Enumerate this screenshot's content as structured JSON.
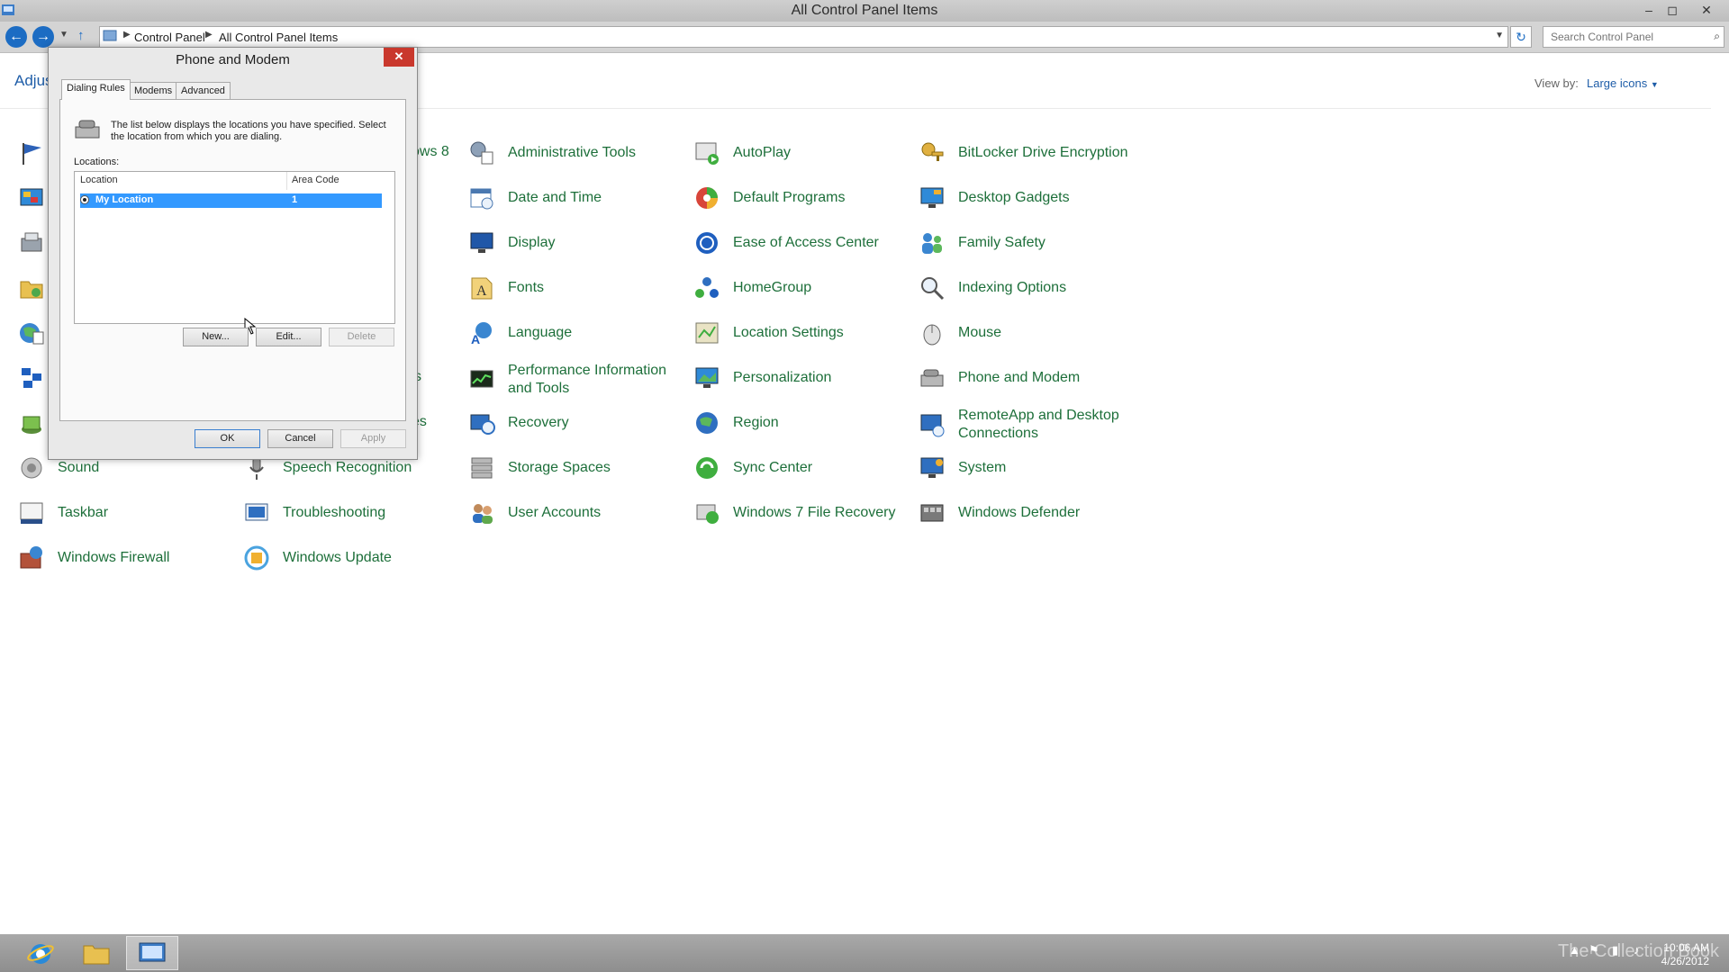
{
  "window": {
    "title": "All Control Panel Items"
  },
  "address_bar": {
    "crumbs": [
      "Control Panel",
      "All Control Panel Items"
    ],
    "search_placeholder": "Search Control Panel"
  },
  "header": {
    "adjust_text": "Adjus",
    "view_by_label": "View by:",
    "view_by_value": "Large icons"
  },
  "partial_labels": {
    "windows8": "ows 8",
    "es1": "s",
    "es2": "es"
  },
  "items": {
    "administrative_tools": "Administrative Tools",
    "autoplay": "AutoPlay",
    "bitlocker": "BitLocker Drive Encryption",
    "date_time": "Date and Time",
    "default_programs": "Default Programs",
    "desktop_gadgets": "Desktop Gadgets",
    "display": "Display",
    "ease_of_access": "Ease of Access Center",
    "family_safety": "Family Safety",
    "fonts": "Fonts",
    "homegroup": "HomeGroup",
    "indexing_options": "Indexing Options",
    "language": "Language",
    "location_settings": "Location Settings",
    "mouse": "Mouse",
    "performance_line1": "Performance Information",
    "performance_line2": "and Tools",
    "personalization": "Personalization",
    "phone_modem": "Phone and Modem",
    "recovery": "Recovery",
    "region": "Region",
    "remoteapp_line1": "RemoteApp and Desktop",
    "remoteapp_line2": "Connections",
    "sound": "Sound",
    "speech_recognition": "Speech Recognition",
    "storage_spaces": "Storage Spaces",
    "sync_center": "Sync Center",
    "system": "System",
    "taskbar": "Taskbar",
    "troubleshooting": "Troubleshooting",
    "user_accounts": "User Accounts",
    "win7_file_recovery": "Windows 7 File Recovery",
    "windows_defender": "Windows Defender",
    "windows_firewall": "Windows Firewall",
    "windows_update": "Windows Update"
  },
  "dialog": {
    "title": "Phone and Modem",
    "tabs": [
      "Dialing Rules",
      "Modems",
      "Advanced"
    ],
    "description": "The list below displays the locations you have specified. Select the location from which you are dialing.",
    "locations_label": "Locations:",
    "columns": [
      "Location",
      "Area Code"
    ],
    "rows": [
      {
        "location": "My Location",
        "area_code": "1"
      }
    ],
    "buttons": {
      "new": "New...",
      "edit": "Edit...",
      "delete": "Delete",
      "ok": "OK",
      "cancel": "Cancel",
      "apply": "Apply"
    }
  },
  "taskbar": {
    "time": "10:06 AM",
    "date": "4/26/2012",
    "watermark": "The Collection Book"
  },
  "colors": {
    "link_green": "#1d6f3a",
    "accent_blue": "#1c6cc3",
    "selection": "#3399ff",
    "close_red": "#c9382d"
  }
}
